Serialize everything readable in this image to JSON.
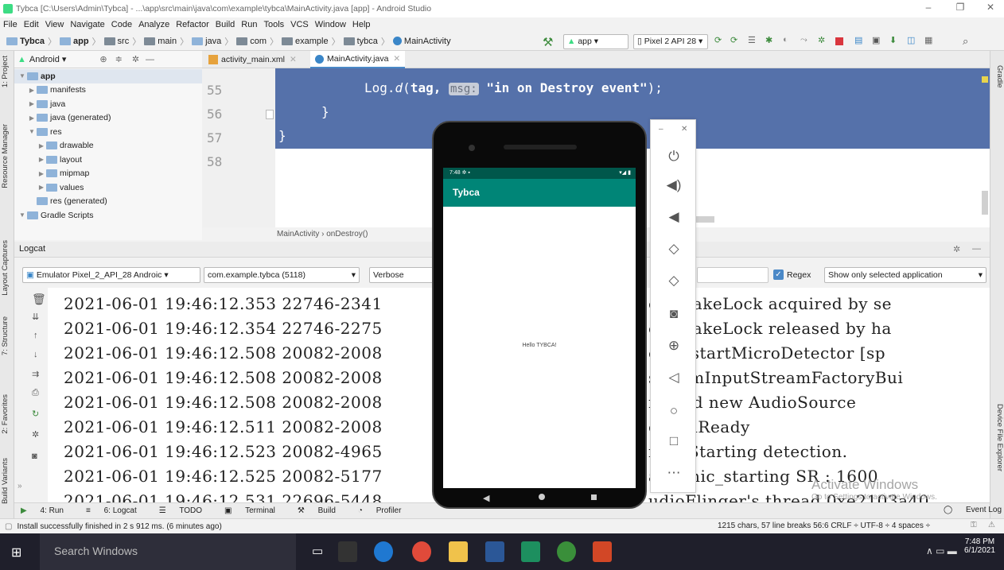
{
  "window": {
    "title": "Tybca [C:\\Users\\Admin\\Tybca] - ...\\app\\src\\main\\java\\com\\example\\tybca\\MainActivity.java [app] - Android Studio",
    "minimize": "–",
    "restore": "❐",
    "close": "✕"
  },
  "menu": [
    "File",
    "Edit",
    "View",
    "Navigate",
    "Code",
    "Analyze",
    "Refactor",
    "Build",
    "Run",
    "Tools",
    "VCS",
    "Window",
    "Help"
  ],
  "breadcrumb": [
    "Tybca",
    "app",
    "src",
    "main",
    "java",
    "com",
    "example",
    "tybca",
    "MainActivity"
  ],
  "toolbar": {
    "run_config": "app",
    "device": "Pixel 2 API 28"
  },
  "left_tabs": {
    "project": "1: Project",
    "resource_manager": "Resource Manager",
    "layout_captures": "Layout Captures",
    "structure": "7: Structure",
    "favorites": "2: Favorites",
    "build_variants": "Build Variants"
  },
  "right_tabs": {
    "gradle": "Gradle",
    "device_file_explorer": "Device File Explorer"
  },
  "project_panel": {
    "view": "Android",
    "tree": [
      {
        "label": "app",
        "depth": 0,
        "open": true,
        "bold": true
      },
      {
        "label": "manifests",
        "depth": 1,
        "open": false
      },
      {
        "label": "java",
        "depth": 1,
        "open": false
      },
      {
        "label": "java (generated)",
        "depth": 1,
        "open": false
      },
      {
        "label": "res",
        "depth": 1,
        "open": true
      },
      {
        "label": "drawable",
        "depth": 2,
        "open": false
      },
      {
        "label": "layout",
        "depth": 2,
        "open": false
      },
      {
        "label": "mipmap",
        "depth": 2,
        "open": false
      },
      {
        "label": "values",
        "depth": 2,
        "open": false
      },
      {
        "label": "res (generated)",
        "depth": 1,
        "open": null
      },
      {
        "label": "Gradle Scripts",
        "depth": 0,
        "open": true
      }
    ]
  },
  "editor": {
    "tabs": [
      "activity_main.xml",
      "MainActivity.java"
    ],
    "line_numbers": [
      "55",
      "56",
      "57",
      "58"
    ],
    "code": {
      "l55_pre": "Log.",
      "l55_fn": "d",
      "l55_paren": "(",
      "l55_tag": "tag, ",
      "l55_hint": "msg:",
      "l55_str": " \"in on Destroy event\"",
      "l55_end": ");",
      "l56": "}",
      "l57": "}"
    },
    "crumbs": "MainActivity  ›  onDestroy()"
  },
  "logcat": {
    "title": "Logcat",
    "device": "Emulator Pixel_2_API_28 Androic",
    "process": "com.example.tybca (5118)",
    "level": "Verbose",
    "regex_label": "Regex",
    "filter": "Show only selected application",
    "lines": [
      {
        "left": "2021-06-01 19:46:12.353 22746-2341",
        "right": "er: WakeLock acquired by se"
      },
      {
        "left": "2021-06-01 19:46:12.354 22746-2275",
        "right": "er: WakeLock released by ha"
      },
      {
        "left": "2021-06-01 19:46:12.508 20082-2008",
        "right": "er: #startMicroDetector [sp"
      },
      {
        "left": "2021-06-01 19:46:12.508 20082-2008",
        "right": "sing mInputStreamFactoryBui"
      },
      {
        "left": "2021-06-01 19:46:12.508 20082-2008",
        "right": "reated new AudioSource"
      },
      {
        "left": "2021-06-01 19:46:12.511 20082-2008",
        "right": "er: onReady"
      },
      {
        "left": "2021-06-01 19:46:12.523 20082-4965",
        "right": "ner: Starting detection."
      },
      {
        "left": "2021-06-01 19:46:12.525 20082-5177",
        "right": "am: mic_starting SR : 1600"
      },
      {
        "left": "2021-06-01 19:46:12.531 22696-5448",
        "right": "udioFlinger's thread 0xe2103a40"
      }
    ]
  },
  "bottom_tabs": [
    "4: Run",
    "6: Logcat",
    "TODO",
    "Terminal",
    "Build",
    "Profiler"
  ],
  "event_log": "Event Log",
  "status": {
    "message": "Install successfully finished in 2 s 912 ms. (6 minutes ago)",
    "info": "1215 chars, 57 line breaks   56:6   CRLF ÷   UTF-8 ÷   4 spaces ÷"
  },
  "watermark": {
    "line1": "Activate Windows",
    "line2": "Go to Settings to activate Windows."
  },
  "phone": {
    "time": "7:48",
    "app_title": "Tybca",
    "content": "Hello TYBCA!",
    "appbar_color": "#008577"
  },
  "taskbar": {
    "search": "Search Windows",
    "time": "7:48 PM",
    "date": "6/1/2021"
  }
}
